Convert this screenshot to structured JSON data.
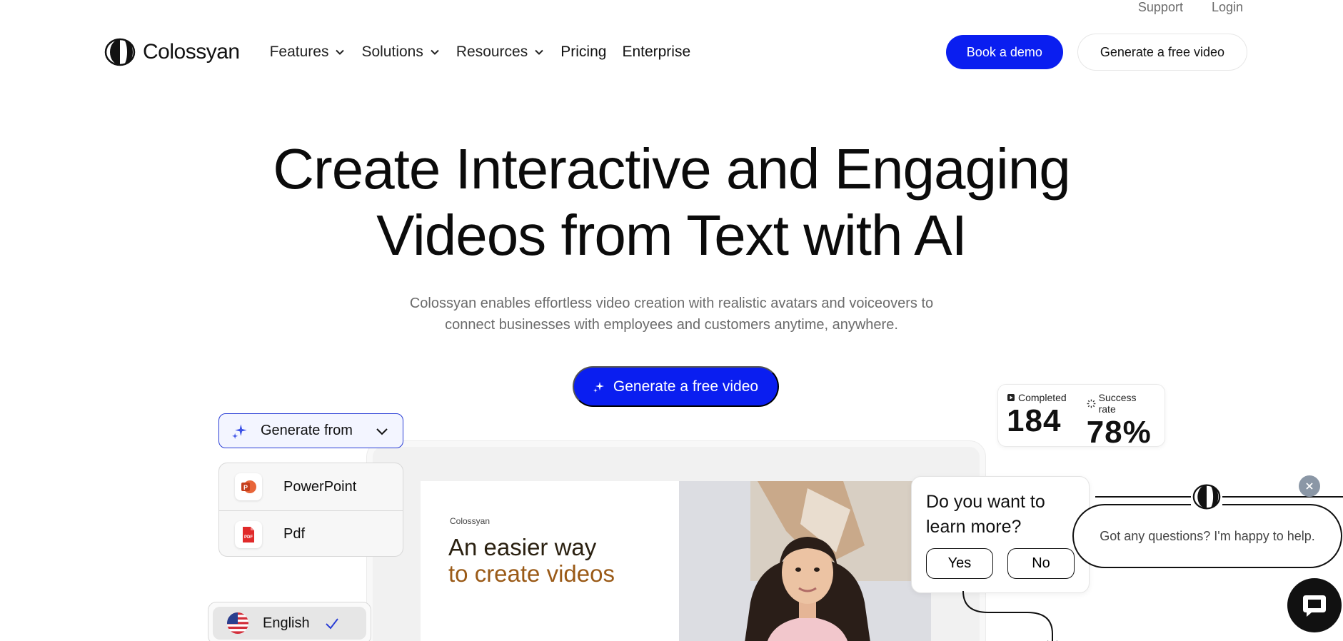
{
  "utility": {
    "support": "Support",
    "login": "Login"
  },
  "brand": {
    "name": "Colossyan",
    "accent": "#0a1ef0"
  },
  "nav": {
    "items": [
      {
        "label": "Features",
        "dropdown": true
      },
      {
        "label": "Solutions",
        "dropdown": true
      },
      {
        "label": "Resources",
        "dropdown": true
      },
      {
        "label": "Pricing",
        "dropdown": false
      },
      {
        "label": "Enterprise",
        "dropdown": false
      }
    ],
    "book_demo": "Book a demo",
    "free_video": "Generate a free video"
  },
  "hero": {
    "title_line1": "Create Interactive and Engaging",
    "title_line2": "Videos from Text with AI",
    "subtitle_line1": "Colossyan enables effortless video creation with realistic avatars and voiceovers to",
    "subtitle_line2": "connect businesses with employees and customers anytime, anywhere.",
    "cta": "Generate a free video",
    "cta_icon": "sparkle-icon"
  },
  "generate_from": {
    "label": "Generate from",
    "icon": "sparkle-icon",
    "options": [
      {
        "label": "PowerPoint",
        "icon": "powerpoint-icon"
      },
      {
        "label": "Pdf",
        "icon": "pdf-icon"
      }
    ]
  },
  "language": {
    "selected": "English",
    "flag": "us-flag-icon"
  },
  "slide": {
    "brand": "Colossyan",
    "headline_line1": "An easier way",
    "headline_line2": "to create videos"
  },
  "stats": {
    "completed_label": "Completed",
    "completed_value": "184",
    "success_label": "Success rate",
    "success_value": "78%"
  },
  "learn_more": {
    "question": "Do you want to learn more?",
    "yes": "Yes",
    "no": "No"
  },
  "chat": {
    "message": "Got any questions? I'm happy to help."
  }
}
